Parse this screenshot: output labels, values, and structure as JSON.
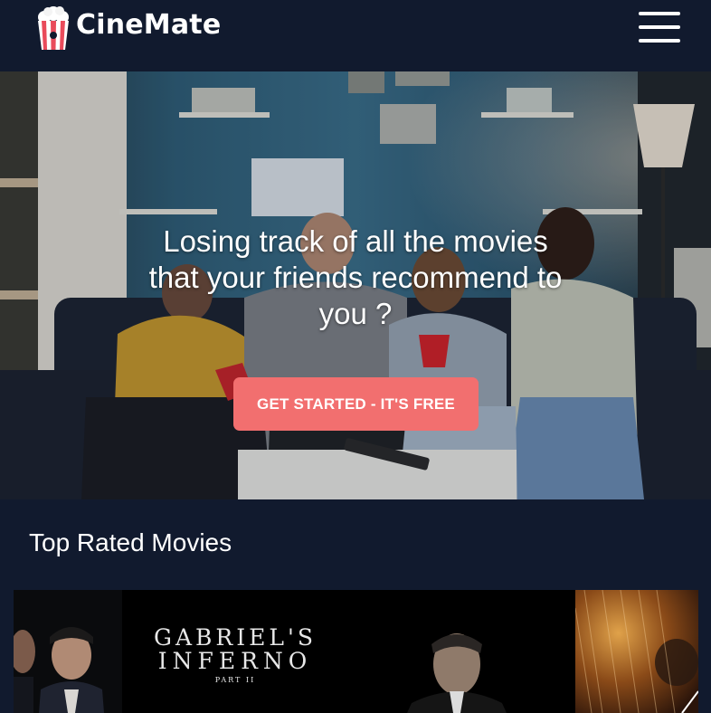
{
  "brand": {
    "name": "CineMate",
    "logo_icon": "popcorn-icon"
  },
  "nav": {
    "menu_icon": "hamburger-menu-icon"
  },
  "hero": {
    "headline_line1": "Losing track of all the movies",
    "headline_line2": "that your friends recommend to",
    "headline_line3": "you ?",
    "cta_label": "GET STARTED - IT'S FREE"
  },
  "colors": {
    "background": "#111a2e",
    "cta": "#f26f6f",
    "text": "#ffffff"
  },
  "top_rated": {
    "title": "Top Rated Movies",
    "posters": [
      {
        "title_line1": "GABRIEL'S",
        "title_line2": "INFERNO",
        "subtitle": "PART II"
      }
    ]
  }
}
